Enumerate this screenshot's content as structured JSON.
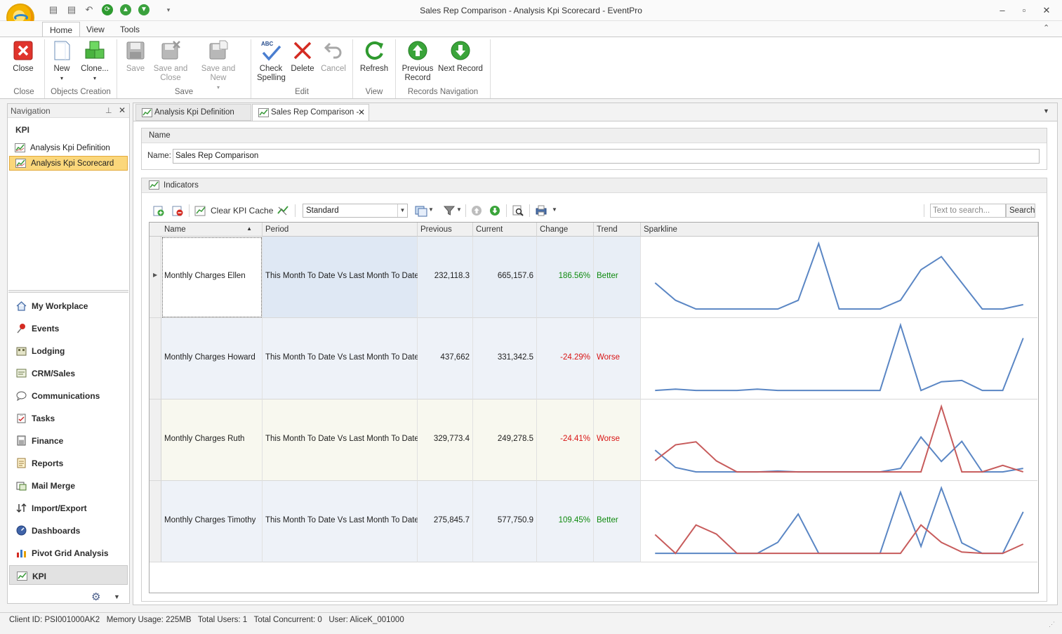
{
  "window": {
    "title": "Sales Rep Comparison - Analysis Kpi Scorecard - EventPro"
  },
  "ribbon": {
    "tabs": [
      "Home",
      "View",
      "Tools"
    ],
    "buttons": {
      "close": "Close",
      "new": "New",
      "clone": "Clone...",
      "save": "Save",
      "save_close": "Save and Close",
      "save_new": "Save and New",
      "check_spelling": "Check Spelling",
      "delete": "Delete",
      "cancel": "Cancel",
      "refresh": "Refresh",
      "previous_record": "Previous Record",
      "next_record": "Next Record"
    },
    "groups": {
      "close": "Close",
      "objects_creation": "Objects Creation",
      "save": "Save",
      "edit": "Edit",
      "view": "View",
      "records_navigation": "Records Navigation"
    }
  },
  "navigation": {
    "title": "Navigation",
    "section": "KPI",
    "items": [
      "Analysis Kpi Definition",
      "Analysis Kpi Scorecard"
    ],
    "modules": [
      "My Workplace",
      "Events",
      "Lodging",
      "CRM/Sales",
      "Communications",
      "Tasks",
      "Finance",
      "Reports",
      "Mail Merge",
      "Import/Export",
      "Dashboards",
      "Pivot Grid Analysis",
      "KPI"
    ]
  },
  "doc_tabs": [
    "Analysis Kpi Definition",
    "Sales Rep Comparison -"
  ],
  "name_section": {
    "header": "Name",
    "label": "Name:",
    "value": "Sales Rep Comparison"
  },
  "indicators": {
    "header": "Indicators",
    "toolbar": {
      "clear_cache": "Clear KPI Cache",
      "layout": "Standard",
      "search_placeholder": "Text to search...",
      "search_button": "Search"
    },
    "columns": [
      "Name",
      "Period",
      "Previous",
      "Current",
      "Change",
      "Trend",
      "Sparkline"
    ],
    "rows": [
      {
        "name": "Monthly Charges Ellen",
        "period": "This Month To Date Vs Last Month To Date",
        "previous": "232,118.3",
        "current": "665,157.6",
        "change": "186.56%",
        "trend": "Better"
      },
      {
        "name": "Monthly Charges Howard",
        "period": "This Month To Date Vs Last Month To Date",
        "previous": "437,662",
        "current": "331,342.5",
        "change": "-24.29%",
        "trend": "Worse"
      },
      {
        "name": "Monthly Charges Ruth",
        "period": "This Month To Date Vs Last Month To Date",
        "previous": "329,773.4",
        "current": "249,278.5",
        "change": "-24.41%",
        "trend": "Worse"
      },
      {
        "name": "Monthly Charges Timothy",
        "period": "This Month To Date Vs Last Month To Date",
        "previous": "275,845.7",
        "current": "577,750.9",
        "change": "109.45%",
        "trend": "Better"
      }
    ]
  },
  "sparklines": [
    {
      "blue": [
        6,
        2,
        0,
        0,
        0,
        0,
        0,
        2,
        15,
        0,
        0,
        0,
        2,
        9,
        12,
        6,
        0,
        0,
        1
      ],
      "red": []
    },
    {
      "blue": [
        0,
        0.3,
        0,
        0,
        0,
        0.3,
        0,
        0,
        0,
        0,
        0,
        0,
        15,
        0,
        2,
        2.3,
        0,
        0,
        12
      ],
      "red": []
    },
    {
      "blue": [
        5,
        1,
        0,
        0,
        0,
        0,
        0.2,
        0,
        0,
        0,
        0,
        0,
        0.8,
        8,
        2.4,
        7,
        0,
        0,
        0.8
      ],
      "red": [
        2.6,
        6.2,
        6.9,
        2.5,
        0,
        0,
        0,
        0,
        0,
        0,
        0,
        0,
        0,
        0,
        15,
        0,
        0,
        1.5,
        0
      ]
    },
    {
      "blue": [
        0,
        0,
        0,
        0,
        0,
        0,
        2.5,
        9,
        0,
        0,
        0,
        0,
        14,
        1.6,
        15,
        2.4,
        0,
        0,
        9.5
      ],
      "red": [
        4.3,
        0,
        6.5,
        4.4,
        0,
        0,
        0,
        0,
        0,
        0,
        0,
        0,
        0,
        6.5,
        2.5,
        0.3,
        0,
        0,
        2.1
      ]
    }
  ],
  "colors": {
    "blue": "#5a86c4",
    "red": "#c75b5b",
    "better": "#0f8a0f",
    "worse": "#d81414",
    "selected_nav": "#fbd77b"
  },
  "status": {
    "text": "Client ID: PSI001000AK2   Memory Usage: 225MB   Total Users: 1   Total Concurrent: 0   User: AliceK_001000"
  }
}
